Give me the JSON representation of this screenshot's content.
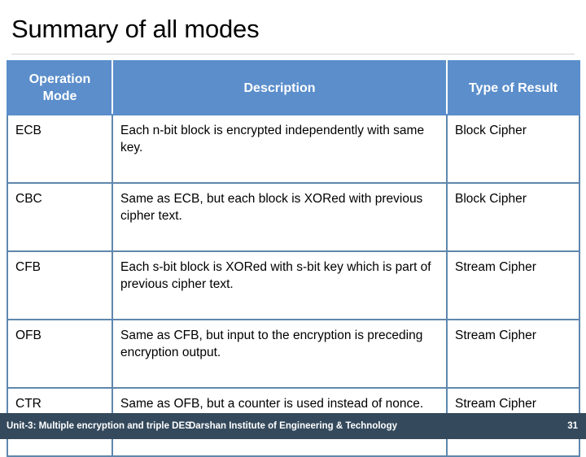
{
  "slide": {
    "title": "Summary of all modes",
    "accent_color": "#5b8ecb",
    "border_color": "#5f87ad",
    "footer_color": "#34495c",
    "title_rule_color": "#d3d3d3"
  },
  "table": {
    "headers": {
      "col1_line1": "Operation",
      "col1_line2": "Mode",
      "col2": "Description",
      "col3": "Type of Result"
    },
    "rows": [
      {
        "mode": "ECB",
        "description": "Each n-bit block is encrypted independently with same key.",
        "type": "Block Cipher"
      },
      {
        "mode": "CBC",
        "description": "Same as ECB, but each block is XORed with previous cipher text.",
        "type": "Block Cipher"
      },
      {
        "mode": "CFB",
        "description": "Each s-bit block is XORed with s-bit key which is part of previous cipher text.",
        "type": "Stream Cipher"
      },
      {
        "mode": "OFB",
        "description": "Same as CFB, but input to the encryption is preceding encryption output.",
        "type": "Stream Cipher"
      },
      {
        "mode": "CTR",
        "description": "Same as OFB, but a counter is used instead of nonce.",
        "type": "Stream Cipher"
      }
    ]
  },
  "footer": {
    "left": "Unit-3: Multiple encryption and triple DES",
    "center": "Darshan Institute of Engineering & Technology",
    "page": "31"
  }
}
